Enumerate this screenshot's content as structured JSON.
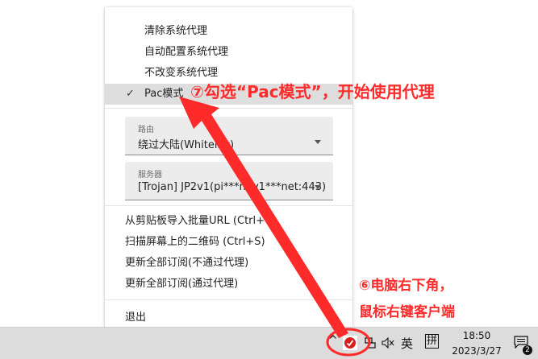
{
  "menu": {
    "proxy_modes": [
      {
        "label": "清除系统代理"
      },
      {
        "label": "自动配置系统代理"
      },
      {
        "label": "不改变系统代理"
      },
      {
        "label": "Pac模式",
        "checked": true
      }
    ],
    "route": {
      "caption": "路由",
      "value": "绕过大陆(Whitelist)"
    },
    "server": {
      "caption": "服务器",
      "value": "[Trojan] JP2v1(pi***n2v1***net:443)"
    },
    "actions": [
      {
        "label": "从剪贴板导入批量URL (Ctrl+V)"
      },
      {
        "label": "扫描屏幕上的二维码 (Ctrl+S)"
      },
      {
        "label": "更新全部订阅(不通过代理)"
      },
      {
        "label": "更新全部订阅(通过代理)"
      }
    ],
    "exit_label": "退出",
    "check_glyph": "✓"
  },
  "annotations": {
    "step7": "⑦勾选“Pac模式”，开始使用代理",
    "step6_line1": "⑥电脑右下角，",
    "step6_line2": "鼠标右键客户端",
    "color": "#ff2a2a"
  },
  "taskbar": {
    "chevron": "^",
    "speaker": "🔇",
    "ime_lang": "英",
    "ime_mode": "拼",
    "time": "18:50",
    "date": "2023/3/27",
    "notification_count": "2"
  }
}
